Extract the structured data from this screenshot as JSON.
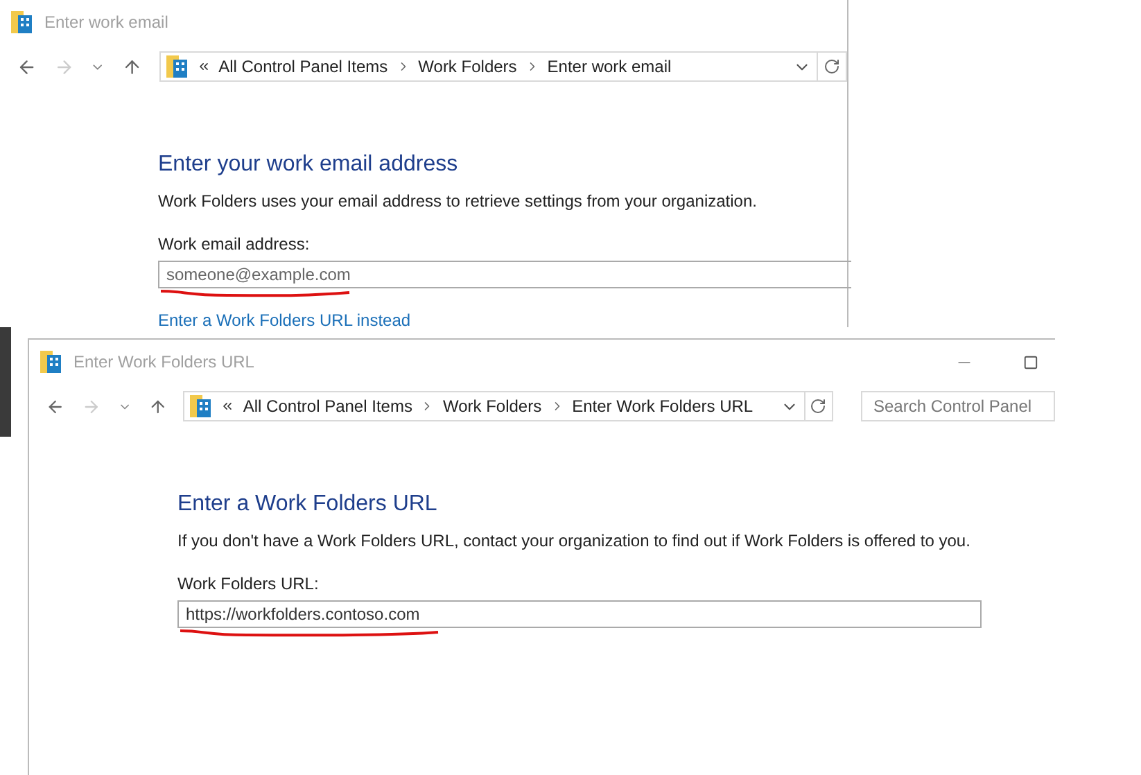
{
  "windows": [
    {
      "title": "Enter work email",
      "breadcrumb": [
        "All Control Panel Items",
        "Work Folders",
        "Enter work email"
      ],
      "heading": "Enter your work email address",
      "description": "Work Folders uses your email address to retrieve settings from your organization.",
      "field_label": "Work email address:",
      "field": {
        "placeholder": "someone@example.com"
      },
      "link": "Enter a Work Folders URL instead"
    },
    {
      "title": "Enter Work Folders URL",
      "breadcrumb": [
        "All Control Panel Items",
        "Work Folders",
        "Enter Work Folders URL"
      ],
      "search": {
        "placeholder": "Search Control Panel"
      },
      "heading": "Enter a Work Folders URL",
      "description": "If you don't have a Work Folders URL, contact your organization to find out if Work Folders is offered to you.",
      "field_label": "Work Folders URL:",
      "field": {
        "value": "https://workfolders.contoso.com"
      }
    }
  ]
}
